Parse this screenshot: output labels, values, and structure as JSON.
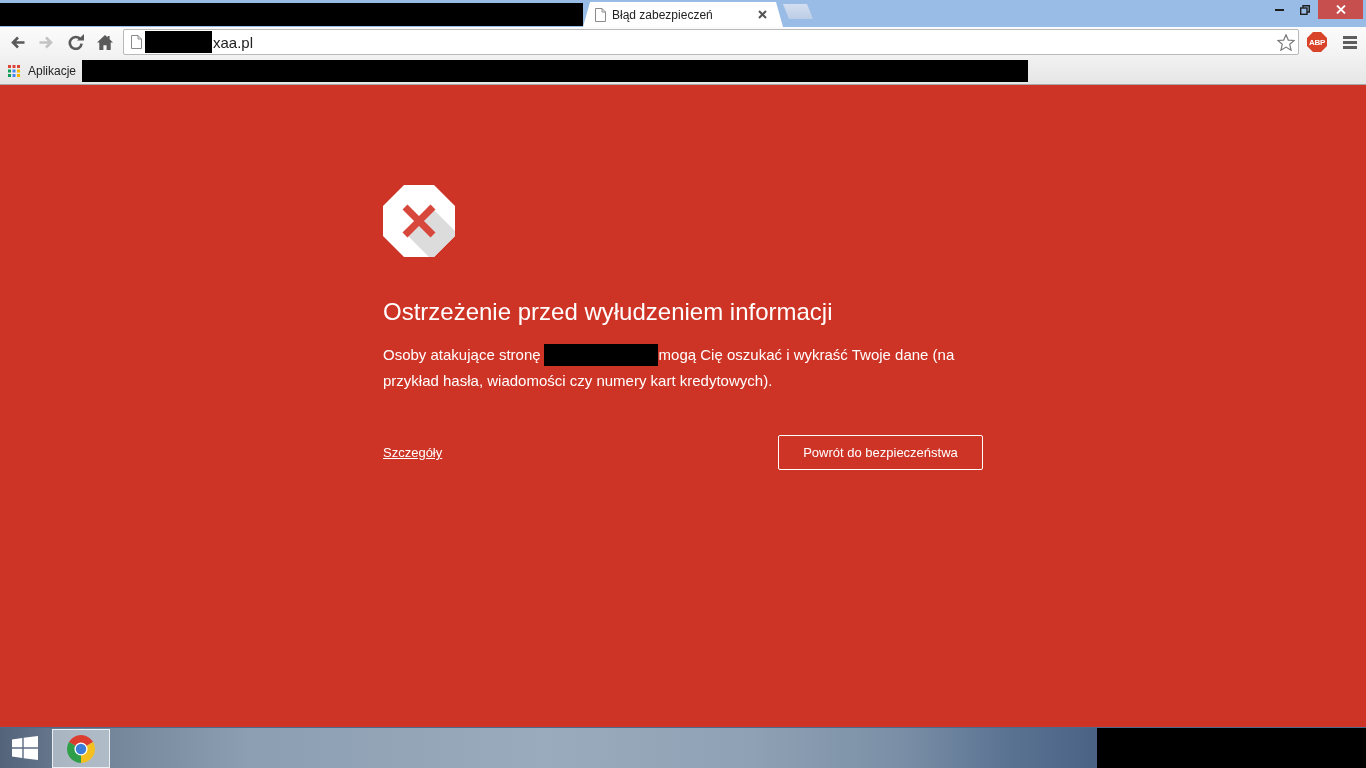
{
  "title_bar": {
    "redacted": true,
    "tabs": [
      {
        "title": "Błąd zabezpieczeń",
        "selected": true
      }
    ]
  },
  "toolbar": {
    "nav_buttons": [
      {
        "kind": "back",
        "disabled": false
      },
      {
        "kind": "forward",
        "disabled": true
      },
      {
        "kind": "reload",
        "disabled": false
      },
      {
        "kind": "home",
        "disabled": false
      }
    ],
    "address_bar": {
      "parts": [
        {
          "kind": "redacted"
        },
        {
          "kind": "text",
          "text": "xaa.pl"
        }
      ]
    },
    "extension": {
      "label": "ABP"
    }
  },
  "bookmarks_bar": {
    "apps_label": "Aplikacje",
    "redacted": true
  },
  "warning": {
    "heading": "Ostrzeżenie przed wyłudzeniem informacji",
    "message": [
      {
        "kind": "text",
        "text": "Osoby atakujące stronę"
      },
      {
        "kind": "redacted"
      },
      {
        "kind": "text",
        "text": "mogą Cię oszukać i wykraść Twoje dane (na przykład hasła, wiadomości czy numery kart kredytowych)."
      }
    ],
    "details_link": "Szczegóły",
    "back_button": "Powrót do bezpieczeństwa"
  },
  "taskbar": {
    "apps": [
      {
        "kind": "browser",
        "active": true
      }
    ],
    "redacted": true
  }
}
